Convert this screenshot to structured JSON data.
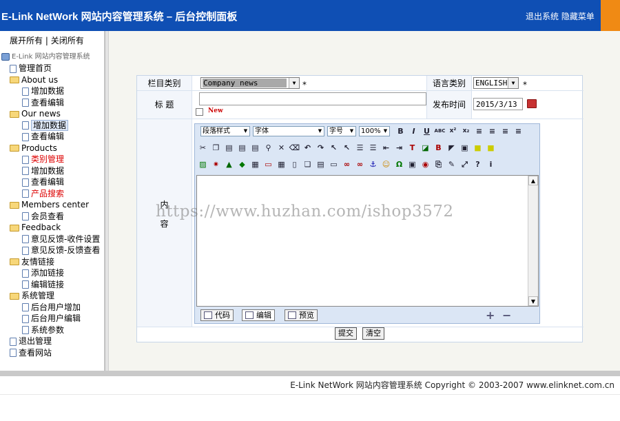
{
  "header": {
    "title": "E-Link NetWork 网站内容管理系统 – 后台控制面板",
    "logout_label": "退出系统",
    "hide_menu_label": "隐藏菜单",
    "bg_color": "#0f4fb4",
    "accent_color": "#f08a14"
  },
  "sidebar": {
    "expand_all": "展开所有",
    "collapse_all": "关闭所有",
    "separator": "|",
    "root_label": "E-Link 网站内容管理系统",
    "items": [
      {
        "label": "管理首页",
        "type": "doc",
        "level": 1
      },
      {
        "label": "About us",
        "type": "folder",
        "level": 1
      },
      {
        "label": "增加数据",
        "type": "doc",
        "level": 2
      },
      {
        "label": "查看编辑",
        "type": "doc",
        "level": 2
      },
      {
        "label": "Our news",
        "type": "folder",
        "level": 1
      },
      {
        "label": "增加数据",
        "type": "doc",
        "level": 2,
        "selected": true
      },
      {
        "label": "查看编辑",
        "type": "doc",
        "level": 2
      },
      {
        "label": "Products",
        "type": "folder",
        "level": 1
      },
      {
        "label": "类别管理",
        "type": "doc",
        "level": 2,
        "red": true
      },
      {
        "label": "增加数据",
        "type": "doc",
        "level": 2
      },
      {
        "label": "查看编辑",
        "type": "doc",
        "level": 2
      },
      {
        "label": "产品搜索",
        "type": "doc",
        "level": 2,
        "red": true
      },
      {
        "label": "Members center",
        "type": "folder",
        "level": 1
      },
      {
        "label": "会员查看",
        "type": "doc",
        "level": 2
      },
      {
        "label": "Feedback",
        "type": "folder",
        "level": 1
      },
      {
        "label": "意见反馈-收件设置",
        "type": "doc",
        "level": 2
      },
      {
        "label": "意见反馈-反馈查看",
        "type": "doc",
        "level": 2
      },
      {
        "label": "友情链接",
        "type": "folder",
        "level": 1
      },
      {
        "label": "添加链接",
        "type": "doc",
        "level": 2
      },
      {
        "label": "编辑链接",
        "type": "doc",
        "level": 2
      },
      {
        "label": "系统管理",
        "type": "folder",
        "level": 1
      },
      {
        "label": "后台用户增加",
        "type": "doc",
        "level": 2
      },
      {
        "label": "后台用户编辑",
        "type": "doc",
        "level": 2
      },
      {
        "label": "系统参数",
        "type": "doc",
        "level": 2
      },
      {
        "label": "退出管理",
        "type": "doc",
        "level": 1
      },
      {
        "label": "查看网站",
        "type": "doc",
        "level": 1
      }
    ]
  },
  "form": {
    "category_label": "栏目类别",
    "category_value": "Company news",
    "required_mark": "*",
    "language_label": "语言类别",
    "language_value": "ENGLISH",
    "title_label": "标 题",
    "title_value": "",
    "new_checkbox_label": "New",
    "date_label": "发布时间",
    "date_value": "2015/3/13",
    "content_label_1": "内",
    "content_label_2": "容",
    "submit_label": "提交",
    "clear_label": "清空"
  },
  "editor": {
    "paragraph_style": "段落样式",
    "font": "字体",
    "font_size": "字号",
    "zoom": "100%",
    "modes": {
      "code": "代码",
      "edit": "编辑",
      "preview": "预览"
    },
    "plus": "+",
    "minus": "−"
  },
  "watermark": "https://www.huzhan.com/ishop3572",
  "footer": {
    "text": "E-Link NetWork 网站内容管理系统 Copyright © 2003-2007 www.elinknet.com.cn"
  }
}
